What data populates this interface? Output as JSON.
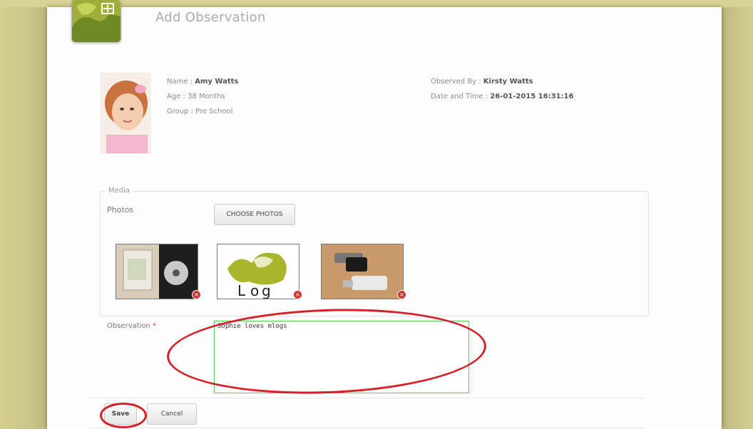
{
  "page": {
    "title": "Add Observation"
  },
  "child": {
    "name_label": "Name : ",
    "name": "Amy Watts",
    "age_label": "Age :",
    "age": "38 Months",
    "group_label": "Group : ",
    "group": "Pre School"
  },
  "observer": {
    "by_label": "Observed By : ",
    "by": "Kirsty Watts",
    "datetime_label": "Date and Time : ",
    "datetime": "26-01-2015 16:31:16"
  },
  "media": {
    "legend": "Media",
    "photos_label": "Photos",
    "choose_button": "CHOOSE PHOTOS"
  },
  "observation": {
    "label": "Observation",
    "required_mark": "*",
    "value": "Sophie loves mlogs"
  },
  "actions": {
    "save": "Save",
    "cancel": "Cancel"
  },
  "colors": {
    "annotation": "#d61f26",
    "input_border": "#6ac46a",
    "background": "#cfc98a"
  }
}
